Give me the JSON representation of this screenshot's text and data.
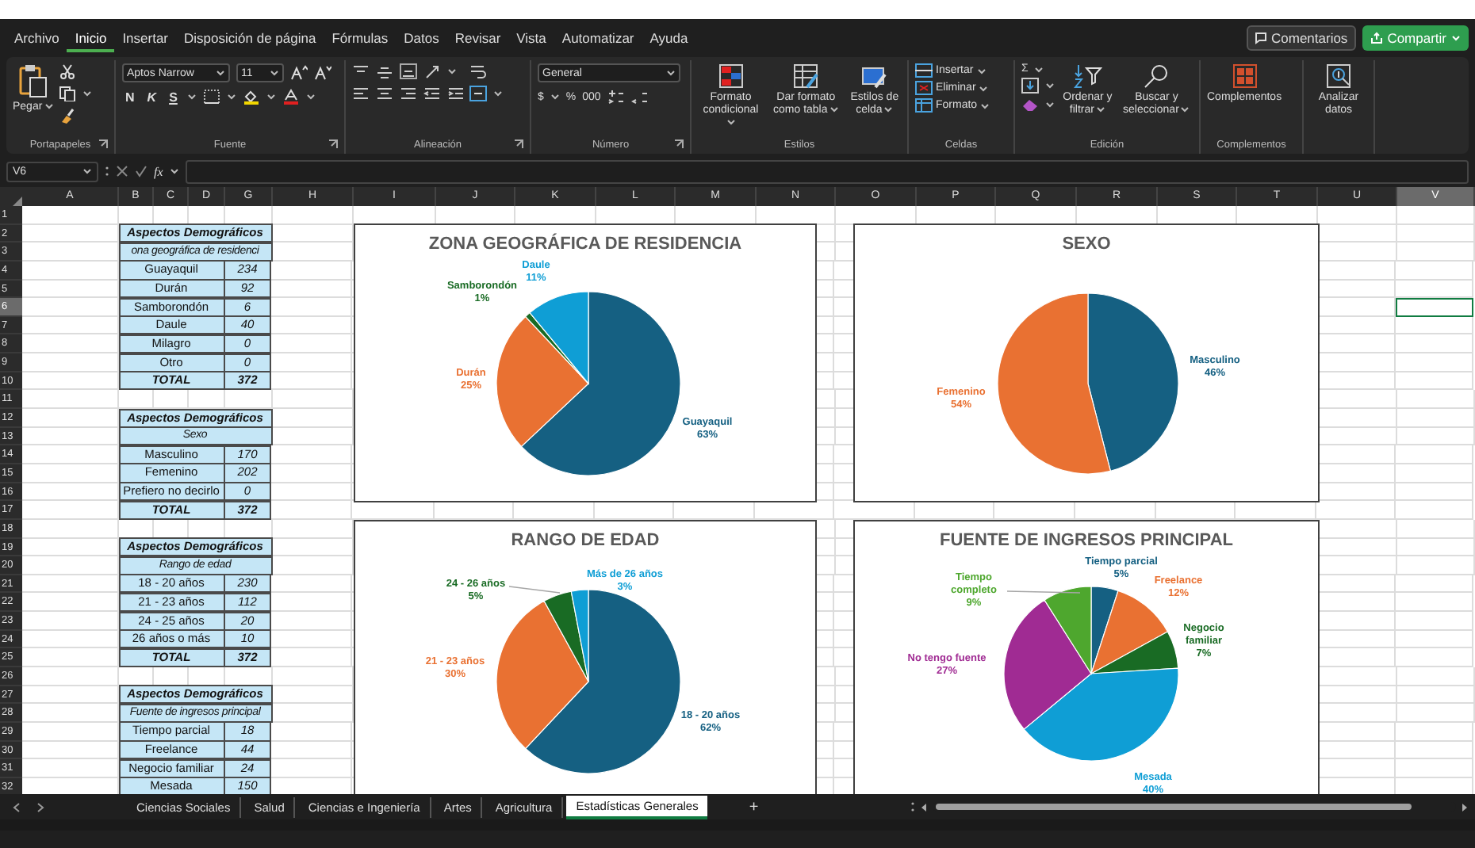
{
  "menu_tabs": [
    {
      "label": "Archivo",
      "selected": false
    },
    {
      "label": "Inicio",
      "selected": true
    },
    {
      "label": "Insertar",
      "selected": false
    },
    {
      "label": "Disposición de página",
      "selected": false
    },
    {
      "label": "Fórmulas",
      "selected": false
    },
    {
      "label": "Datos",
      "selected": false
    },
    {
      "label": "Revisar",
      "selected": false
    },
    {
      "label": "Vista",
      "selected": false
    },
    {
      "label": "Automatizar",
      "selected": false
    },
    {
      "label": "Ayuda",
      "selected": false
    }
  ],
  "comments_button": "Comentarios",
  "share_button": "Compartir",
  "ribbon": {
    "groups": [
      {
        "kind": "clipboard",
        "label": "Portapapeles",
        "paste": "Pegar"
      },
      {
        "kind": "font",
        "label": "Fuente",
        "font_name": "Aptos Narrow",
        "font_size": "11",
        "bold": "N",
        "italic": "K",
        "underline": "S"
      },
      {
        "kind": "alignment",
        "label": "Alineación"
      },
      {
        "kind": "number",
        "label": "Número",
        "format": "General",
        "currency": "$",
        "percent": "%",
        "thousands": "000"
      },
      {
        "kind": "styles",
        "label": "Estilos",
        "buttons": [
          "Formato condicional",
          "Dar formato como tabla",
          "Estilos de celda"
        ]
      },
      {
        "kind": "cells",
        "label": "Celdas",
        "buttons": [
          "Insertar",
          "Eliminar",
          "Formato"
        ]
      },
      {
        "kind": "editing",
        "label": "Edición",
        "sum": "Σ",
        "buttons": [
          "Ordenar y filtrar",
          "Buscar y seleccionar"
        ]
      },
      {
        "kind": "addins",
        "label": "Complementos",
        "button": "Complementos"
      },
      {
        "kind": "analyze",
        "button": "Analizar datos"
      }
    ]
  },
  "formula_bar": {
    "name_box": "V6",
    "fx": "fx"
  },
  "sheet": {
    "columns": [
      {
        "label": "A",
        "selected": false
      },
      {
        "label": "B",
        "selected": false
      },
      {
        "label": "C",
        "selected": false
      },
      {
        "label": "D",
        "selected": false
      },
      {
        "label": "G",
        "selected": false
      },
      {
        "label": "H",
        "selected": false
      },
      {
        "label": "I",
        "selected": false
      },
      {
        "label": "J",
        "selected": false
      },
      {
        "label": "K",
        "selected": false
      },
      {
        "label": "L",
        "selected": false
      },
      {
        "label": "M",
        "selected": false
      },
      {
        "label": "N",
        "selected": false
      },
      {
        "label": "O",
        "selected": false
      },
      {
        "label": "P",
        "selected": false
      },
      {
        "label": "Q",
        "selected": false
      },
      {
        "label": "R",
        "selected": false
      },
      {
        "label": "S",
        "selected": false
      },
      {
        "label": "T",
        "selected": false
      },
      {
        "label": "U",
        "selected": false
      },
      {
        "label": "V",
        "selected": true
      }
    ],
    "rows": [
      {
        "label": "1",
        "selected": false
      },
      {
        "label": "2",
        "selected": false
      },
      {
        "label": "3",
        "selected": false
      },
      {
        "label": "4",
        "selected": false
      },
      {
        "label": "5",
        "selected": false
      },
      {
        "label": "6",
        "selected": true
      },
      {
        "label": "7",
        "selected": false
      },
      {
        "label": "8",
        "selected": false
      },
      {
        "label": "9",
        "selected": false
      },
      {
        "label": "10",
        "selected": false
      },
      {
        "label": "11",
        "selected": false
      },
      {
        "label": "12",
        "selected": false
      },
      {
        "label": "13",
        "selected": false
      },
      {
        "label": "14",
        "selected": false
      },
      {
        "label": "15",
        "selected": false
      },
      {
        "label": "16",
        "selected": false
      },
      {
        "label": "17",
        "selected": false
      },
      {
        "label": "18",
        "selected": false
      },
      {
        "label": "19",
        "selected": false
      },
      {
        "label": "20",
        "selected": false
      },
      {
        "label": "21",
        "selected": false
      },
      {
        "label": "22",
        "selected": false
      },
      {
        "label": "23",
        "selected": false
      },
      {
        "label": "24",
        "selected": false
      },
      {
        "label": "25",
        "selected": false
      },
      {
        "label": "26",
        "selected": false
      },
      {
        "label": "27",
        "selected": false
      },
      {
        "label": "28",
        "selected": false
      },
      {
        "label": "29",
        "selected": false
      },
      {
        "label": "30",
        "selected": false
      },
      {
        "label": "31",
        "selected": false
      },
      {
        "label": "32",
        "selected": false
      }
    ],
    "tables": [
      {
        "title": "Aspectos Demográficos",
        "subtitle": "ona geográfica de residenci",
        "rows": [
          {
            "label": "Guayaquil",
            "value": "234"
          },
          {
            "label": "Durán",
            "value": "92"
          },
          {
            "label": "Samborondón",
            "value": "6"
          },
          {
            "label": "Daule",
            "value": "40"
          },
          {
            "label": "Milagro",
            "value": "0"
          },
          {
            "label": "Otro",
            "value": "0"
          }
        ],
        "total": {
          "label": "TOTAL",
          "value": "372"
        }
      },
      {
        "title": "Aspectos Demográficos",
        "subtitle": "Sexo",
        "rows": [
          {
            "label": "Masculino",
            "value": "170"
          },
          {
            "label": "Femenino",
            "value": "202"
          },
          {
            "label": "Prefiero no decirlo",
            "value": "0"
          }
        ],
        "total": {
          "label": "TOTAL",
          "value": "372"
        }
      },
      {
        "title": "Aspectos Demográficos",
        "subtitle": "Rango de edad",
        "rows": [
          {
            "label": "18 - 20 años",
            "value": "230"
          },
          {
            "label": "21 - 23 años",
            "value": "112"
          },
          {
            "label": "24 - 25 años",
            "value": "20"
          },
          {
            "label": "26 años o más",
            "value": "10"
          }
        ],
        "total": {
          "label": "TOTAL",
          "value": "372"
        }
      },
      {
        "title": "Aspectos Demográficos",
        "subtitle": "Fuente de ingresos principal",
        "rows": [
          {
            "label": "Tiempo parcial",
            "value": "18"
          },
          {
            "label": "Freelance",
            "value": "44"
          },
          {
            "label": "Negocio familiar",
            "value": "24"
          },
          {
            "label": "Mesada",
            "value": "150"
          }
        ]
      }
    ],
    "charts": [
      {
        "chart_data": {
          "type": "pie",
          "title": "ZONA GEOGRÁFICA DE RESIDENCIA",
          "categories": [
            "Guayaquil",
            "Durán",
            "Samborondón",
            "Daule"
          ],
          "values": [
            63,
            25,
            1,
            11
          ],
          "value_labels": [
            "63%",
            "25%",
            "1%",
            "11%"
          ],
          "colors": [
            "#156082",
            "#e97132",
            "#196b24",
            "#0f9ed5"
          ],
          "data_labels": true
        }
      },
      {
        "chart_data": {
          "type": "pie",
          "title": "SEXO",
          "categories": [
            "Masculino",
            "Femenino"
          ],
          "values": [
            46,
            54
          ],
          "value_labels": [
            "46%",
            "54%"
          ],
          "colors": [
            "#156082",
            "#e97132"
          ],
          "data_labels": true
        }
      },
      {
        "chart_data": {
          "type": "pie",
          "title": "RANGO DE EDAD",
          "categories": [
            "18 - 20 años",
            "21 - 23 años",
            "24 - 26 años",
            "Más de 26 años"
          ],
          "values": [
            62,
            30,
            5,
            3
          ],
          "value_labels": [
            "62%",
            "30%",
            "5%",
            "3%"
          ],
          "colors": [
            "#156082",
            "#e97132",
            "#196b24",
            "#0f9ed5"
          ],
          "data_labels": true
        }
      },
      {
        "chart_data": {
          "type": "pie",
          "title": "FUENTE DE INGRESOS PRINCIPAL",
          "categories": [
            "Tiempo parcial",
            "Freelance",
            "Negocio familiar",
            "Mesada",
            "No tengo fuente",
            "Tiempo completo"
          ],
          "values": [
            5,
            12,
            7,
            40,
            27,
            9
          ],
          "value_labels": [
            "5%",
            "12%",
            "7%",
            "40%",
            "27%",
            "9%"
          ],
          "colors": [
            "#156082",
            "#e97132",
            "#196b24",
            "#0f9ed5",
            "#a02b93",
            "#4ea72e"
          ],
          "data_labels": true
        }
      }
    ]
  },
  "sheet_tabs": [
    {
      "label": "Ciencias Sociales",
      "selected": false
    },
    {
      "label": "Salud",
      "selected": false
    },
    {
      "label": "Ciencias e Ingeniería",
      "selected": false
    },
    {
      "label": "Artes",
      "selected": false
    },
    {
      "label": "Agricultura",
      "selected": false
    },
    {
      "label": "Estadísticas Generales",
      "selected": true
    }
  ],
  "add_sheet": "+"
}
